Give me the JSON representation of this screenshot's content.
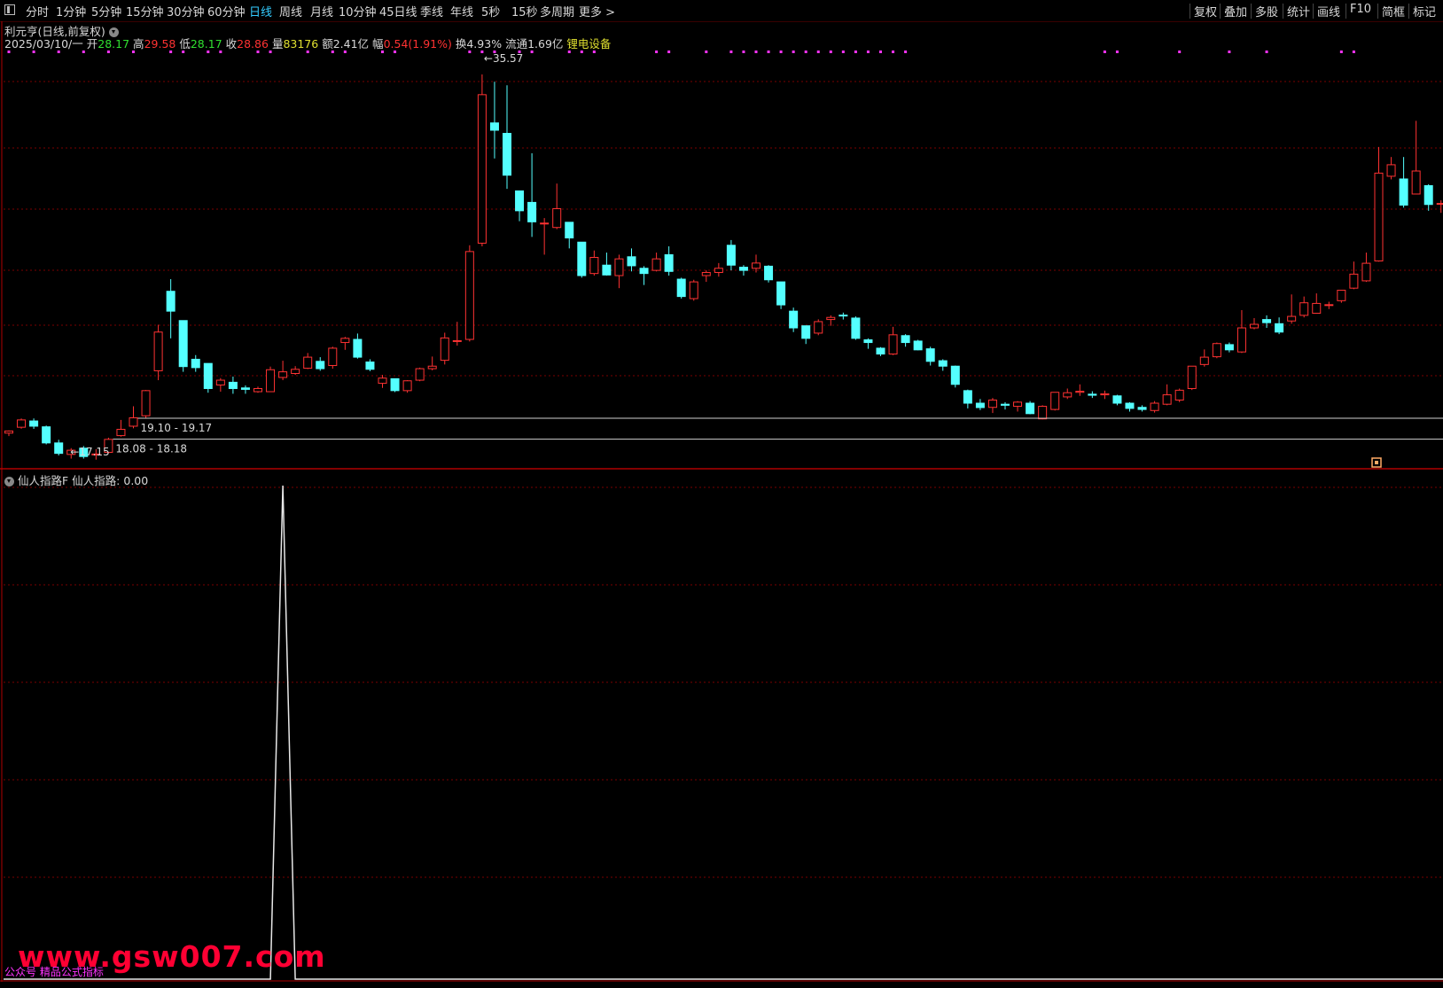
{
  "toolbar": {
    "left_items": [
      {
        "label": "分时",
        "active": false
      },
      {
        "label": "1分钟",
        "active": false
      },
      {
        "label": "5分钟",
        "active": false
      },
      {
        "label": "15分钟",
        "active": false
      },
      {
        "label": "30分钟",
        "active": false
      },
      {
        "label": "60分钟",
        "active": false
      },
      {
        "label": "日线",
        "active": true
      },
      {
        "label": "周线",
        "active": false
      },
      {
        "label": "月线",
        "active": false
      },
      {
        "label": "10分钟",
        "active": false
      },
      {
        "label": "45日线",
        "active": false
      },
      {
        "label": "季线",
        "active": false
      },
      {
        "label": "年线",
        "active": false
      },
      {
        "label": "5秒",
        "active": false
      },
      {
        "label": "15秒",
        "active": false
      },
      {
        "label": "多周期",
        "active": false
      },
      {
        "label": "更多 >",
        "active": false
      }
    ],
    "right_items": [
      "复权",
      "叠加",
      "多股",
      "统计",
      "画线",
      "F10",
      "简框",
      "标记"
    ]
  },
  "stock": {
    "title": "利元亨(日线,前复权)",
    "date": "2025/03/10/一",
    "open_label": "开",
    "open": "28.17",
    "high_label": "高",
    "high": "29.58",
    "low_label": "低",
    "low": "28.17",
    "close_label": "收",
    "close": "28.86",
    "vol_label": "量",
    "vol": "83176",
    "amt_label": "额",
    "amt": "2.41亿",
    "chg_label": "幅",
    "chg": "0.54(1.91%)",
    "turn_label": "换",
    "turn": "4.93%",
    "float_label": "流通",
    "float": "1.69亿",
    "sector": "锂电设备"
  },
  "colors": {
    "up": "#ff3232",
    "down": "#54ffff",
    "grid": "#7a0000",
    "border": "#b00000",
    "open": "#ff3232",
    "high": "#ff3232",
    "low": "#30e030",
    "close": "#ff3232",
    "vol": "#e0e030",
    "sector": "#e0e030",
    "marker": "#ff33ff"
  },
  "annotations": {
    "high_label": "35.57",
    "low_label": "17.15",
    "zone1": "19.10 - 19.17",
    "zone2": "18.08 - 18.18"
  },
  "indicator": {
    "name": "仙人指路F",
    "value_label": "仙人指路:",
    "value": "0.00"
  },
  "watermark": {
    "site": "www.gsw007.com",
    "sub": "公众号 精品公式指标"
  },
  "chart_data": {
    "type": "candlestick",
    "price_range": [
      16.8,
      36.5
    ],
    "candles": [
      [
        18.42,
        18.52,
        18.28,
        18.55
      ],
      [
        18.7,
        19.05,
        18.63,
        19.12
      ],
      [
        19.0,
        18.75,
        18.62,
        19.12
      ],
      [
        18.72,
        17.95,
        17.88,
        18.78
      ],
      [
        17.95,
        17.45,
        17.35,
        18.1
      ],
      [
        17.4,
        17.6,
        17.2,
        17.7
      ],
      [
        17.7,
        17.3,
        17.2,
        17.8
      ],
      [
        17.38,
        17.42,
        17.15,
        17.65
      ],
      [
        17.5,
        18.12,
        17.45,
        18.2
      ],
      [
        18.3,
        18.6,
        18.25,
        19.05
      ],
      [
        18.75,
        19.15,
        18.65,
        19.7
      ],
      [
        19.25,
        20.45,
        19.15,
        20.48
      ],
      [
        21.4,
        23.25,
        20.95,
        23.6
      ],
      [
        25.2,
        24.25,
        22.95,
        25.78
      ],
      [
        23.8,
        21.6,
        21.35,
        23.8
      ],
      [
        21.95,
        21.55,
        21.35,
        22.15
      ],
      [
        21.75,
        20.55,
        20.35,
        21.75
      ],
      [
        20.72,
        20.95,
        20.4,
        21.05
      ],
      [
        20.85,
        20.55,
        20.3,
        21.12
      ],
      [
        20.58,
        20.51,
        20.3,
        20.7
      ],
      [
        20.4,
        20.55,
        20.35,
        20.64
      ],
      [
        20.4,
        21.45,
        20.38,
        21.6
      ],
      [
        21.08,
        21.35,
        20.95,
        21.88
      ],
      [
        21.27,
        21.47,
        21.2,
        21.62
      ],
      [
        21.52,
        22.05,
        21.48,
        22.25
      ],
      [
        21.85,
        21.5,
        21.4,
        22.05
      ],
      [
        21.65,
        22.48,
        21.5,
        22.55
      ],
      [
        22.75,
        22.95,
        22.4,
        23.02
      ],
      [
        22.9,
        22.05,
        21.98,
        23.18
      ],
      [
        21.82,
        21.47,
        21.38,
        21.95
      ],
      [
        20.8,
        21.05,
        20.58,
        21.2
      ],
      [
        21.02,
        20.45,
        20.38,
        21.02
      ],
      [
        20.45,
        20.92,
        20.35,
        20.95
      ],
      [
        20.95,
        21.5,
        20.9,
        21.55
      ],
      [
        21.5,
        21.62,
        21.42,
        22.08
      ],
      [
        21.9,
        22.97,
        21.7,
        23.22
      ],
      [
        22.82,
        22.84,
        22.6,
        23.74
      ],
      [
        22.9,
        27.1,
        22.8,
        27.4
      ],
      [
        27.5,
        34.6,
        27.35,
        35.57
      ],
      [
        33.25,
        32.9,
        31.55,
        35.22
      ],
      [
        32.75,
        30.75,
        30.1,
        35.05
      ],
      [
        30.0,
        29.05,
        28.55,
        30.0
      ],
      [
        29.45,
        28.52,
        27.8,
        31.8
      ],
      [
        28.45,
        28.46,
        26.95,
        28.7
      ],
      [
        28.25,
        29.15,
        28.17,
        30.35
      ],
      [
        28.5,
        27.75,
        27.25,
        28.5
      ],
      [
        27.55,
        25.95,
        25.85,
        27.55
      ],
      [
        26.05,
        26.82,
        25.95,
        27.15
      ],
      [
        26.45,
        25.98,
        25.95,
        27.05
      ],
      [
        25.95,
        26.75,
        25.35,
        26.95
      ],
      [
        26.85,
        26.42,
        26.15,
        27.25
      ],
      [
        26.3,
        26.05,
        25.5,
        26.4
      ],
      [
        26.2,
        26.75,
        26.15,
        27.05
      ],
      [
        26.95,
        26.15,
        25.95,
        27.35
      ],
      [
        25.78,
        24.95,
        24.85,
        25.85
      ],
      [
        24.85,
        25.65,
        24.75,
        25.75
      ],
      [
        25.95,
        26.1,
        25.65,
        26.2
      ],
      [
        26.1,
        26.3,
        25.9,
        26.55
      ],
      [
        27.4,
        26.45,
        26.2,
        27.65
      ],
      [
        26.35,
        26.2,
        25.95,
        26.45
      ],
      [
        26.3,
        26.55,
        26.1,
        26.95
      ],
      [
        26.4,
        25.75,
        25.62,
        26.45
      ],
      [
        25.65,
        24.55,
        24.35,
        25.65
      ],
      [
        24.25,
        23.45,
        23.25,
        24.42
      ],
      [
        23.55,
        22.95,
        22.68,
        23.55
      ],
      [
        23.2,
        23.75,
        23.1,
        23.86
      ],
      [
        23.85,
        23.95,
        23.55,
        24.05
      ],
      [
        24.06,
        24.02,
        23.85,
        24.18
      ],
      [
        23.92,
        22.95,
        22.88,
        24.0
      ],
      [
        22.88,
        22.75,
        22.45,
        22.95
      ],
      [
        22.48,
        22.2,
        22.1,
        22.53
      ],
      [
        22.2,
        23.12,
        22.15,
        23.5
      ],
      [
        23.08,
        22.75,
        22.55,
        23.15
      ],
      [
        22.82,
        22.4,
        22.38,
        22.88
      ],
      [
        22.45,
        21.85,
        21.65,
        22.55
      ],
      [
        21.88,
        21.62,
        21.4,
        21.95
      ],
      [
        21.62,
        20.75,
        20.6,
        21.65
      ],
      [
        20.45,
        19.85,
        19.6,
        20.5
      ],
      [
        19.85,
        19.64,
        19.52,
        20.05
      ],
      [
        19.65,
        20.0,
        19.38,
        20.1
      ],
      [
        19.8,
        19.75,
        19.55,
        19.9
      ],
      [
        19.7,
        19.9,
        19.45,
        19.95
      ],
      [
        19.85,
        19.35,
        19.32,
        19.95
      ],
      [
        19.1,
        19.7,
        19.08,
        19.75
      ],
      [
        19.55,
        20.37,
        19.5,
        20.38
      ],
      [
        20.15,
        20.35,
        20.05,
        20.55
      ],
      [
        20.37,
        20.42,
        20.2,
        20.75
      ],
      [
        20.28,
        20.23,
        20.1,
        20.42
      ],
      [
        20.25,
        20.3,
        20.05,
        20.45
      ],
      [
        20.2,
        19.85,
        19.75,
        20.25
      ],
      [
        19.85,
        19.6,
        19.45,
        19.9
      ],
      [
        19.65,
        19.55,
        19.45,
        19.75
      ],
      [
        19.5,
        19.85,
        19.4,
        19.95
      ],
      [
        19.8,
        20.25,
        19.75,
        20.75
      ],
      [
        20.0,
        20.47,
        19.9,
        20.55
      ],
      [
        20.55,
        21.62,
        20.48,
        21.62
      ],
      [
        21.7,
        22.05,
        21.6,
        22.42
      ],
      [
        22.07,
        22.7,
        22.0,
        22.75
      ],
      [
        22.65,
        22.4,
        22.28,
        22.75
      ],
      [
        22.3,
        23.45,
        22.25,
        24.3
      ],
      [
        23.45,
        23.62,
        23.38,
        23.92
      ],
      [
        23.85,
        23.7,
        23.45,
        24.05
      ],
      [
        23.65,
        23.25,
        23.15,
        23.95
      ],
      [
        23.78,
        24.0,
        23.65,
        25.05
      ],
      [
        24.05,
        24.65,
        23.95,
        24.95
      ],
      [
        24.15,
        24.62,
        24.15,
        25.1
      ],
      [
        24.55,
        24.56,
        24.35,
        24.7
      ],
      [
        24.75,
        25.25,
        24.65,
        25.25
      ],
      [
        25.35,
        26.02,
        25.3,
        26.62
      ],
      [
        25.7,
        26.54,
        25.65,
        27.05
      ],
      [
        26.65,
        30.85,
        26.62,
        32.1
      ],
      [
        30.7,
        31.25,
        30.55,
        31.62
      ],
      [
        30.57,
        29.32,
        29.2,
        31.62
      ],
      [
        29.85,
        30.95,
        29.92,
        33.35
      ],
      [
        30.25,
        29.35,
        29.05,
        30.32
      ],
      [
        29.36,
        29.4,
        28.95,
        29.55
      ],
      [
        29.05,
        29.65,
        29.0,
        29.95
      ],
      [
        29.4,
        28.42,
        28.35,
        29.4
      ]
    ],
    "dot_markers_row": true,
    "indicator_series": {
      "name": "仙人指路",
      "peak_candle_index": 22,
      "values_note": "single spike to maximum at one bar, zero elsewhere"
    }
  }
}
